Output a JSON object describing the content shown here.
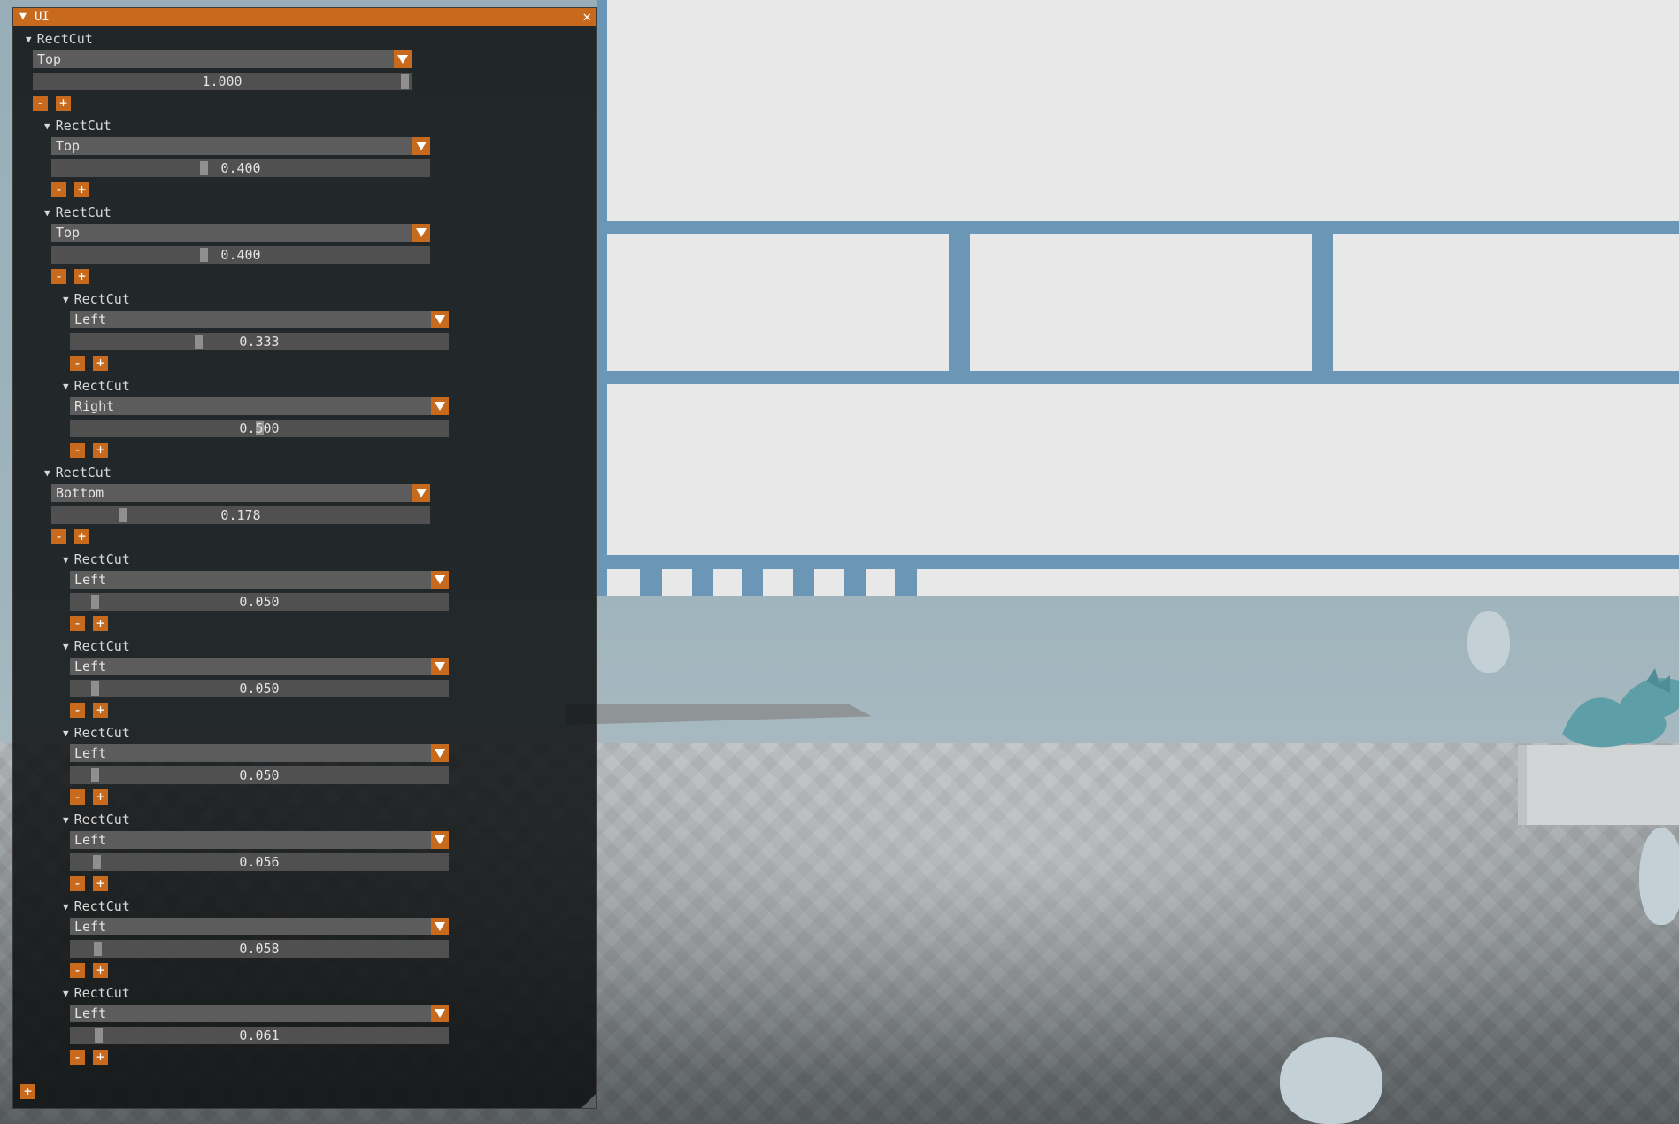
{
  "window": {
    "title": "UI",
    "collapse_icon": "triangle-down-icon",
    "close_icon": "close-x-icon"
  },
  "node_label": "RectCut",
  "nodes": [
    {
      "label": "RectCut",
      "cut": "Top",
      "value": "1.000",
      "slider_fraction": 1.0
    },
    {
      "label": "RectCut",
      "cut": "Top",
      "value": "0.400",
      "slider_fraction": 0.4
    },
    {
      "label": "RectCut",
      "cut": "Top",
      "value": "0.400",
      "slider_fraction": 0.4
    },
    {
      "label": "RectCut",
      "cut": "Left",
      "value": "0.333",
      "slider_fraction": 0.333
    },
    {
      "label": "RectCut",
      "cut": "Right",
      "value": "0.500",
      "slider_fraction": 0.5
    },
    {
      "label": "RectCut",
      "cut": "Bottom",
      "value": "0.178",
      "slider_fraction": 0.178
    },
    {
      "label": "RectCut",
      "cut": "Left",
      "value": "0.050",
      "slider_fraction": 0.05
    },
    {
      "label": "RectCut",
      "cut": "Left",
      "value": "0.050",
      "slider_fraction": 0.05
    },
    {
      "label": "RectCut",
      "cut": "Left",
      "value": "0.050",
      "slider_fraction": 0.05
    },
    {
      "label": "RectCut",
      "cut": "Left",
      "value": "0.056",
      "slider_fraction": 0.056
    },
    {
      "label": "RectCut",
      "cut": "Left",
      "value": "0.058",
      "slider_fraction": 0.058
    },
    {
      "label": "RectCut",
      "cut": "Left",
      "value": "0.061",
      "slider_fraction": 0.061
    }
  ],
  "buttons": {
    "minus": "-",
    "plus": "+"
  },
  "colors": {
    "accent": "#c86a1e",
    "layout_frame": "#6b96b5",
    "layout_rect": "#e8e8e8"
  }
}
